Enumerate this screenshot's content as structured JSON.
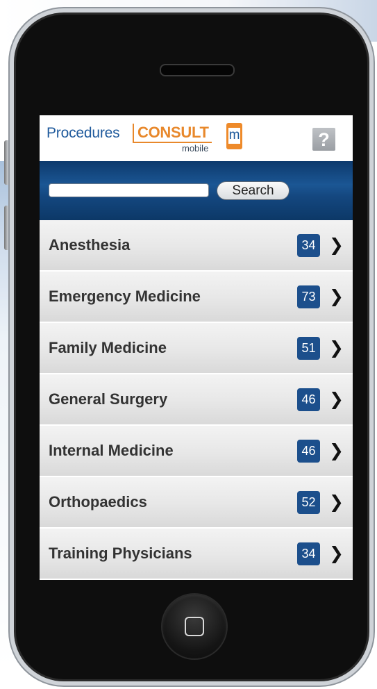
{
  "header": {
    "logo_procedures": "Procedures",
    "logo_consult": "CONSULT",
    "logo_mobile": "mobile",
    "logo_m": "m",
    "help_label": "?"
  },
  "search": {
    "placeholder": "",
    "value": "",
    "button_label": "Search"
  },
  "specialties": [
    {
      "label": "Anesthesia",
      "count": "34"
    },
    {
      "label": "Emergency Medicine",
      "count": "73"
    },
    {
      "label": "Family Medicine",
      "count": "51"
    },
    {
      "label": "General Surgery",
      "count": "46"
    },
    {
      "label": "Internal Medicine",
      "count": "46"
    },
    {
      "label": "Orthopaedics",
      "count": "52"
    },
    {
      "label": "Training Physicians",
      "count": "34"
    }
  ],
  "icons": {
    "chevron": "chevron-right-icon",
    "help": "question-icon",
    "home": "home-button-icon"
  },
  "colors": {
    "brand_blue": "#1f5a9c",
    "brand_orange": "#e8882b",
    "badge_blue": "#1c4f8c",
    "search_bar": "#14477f"
  }
}
